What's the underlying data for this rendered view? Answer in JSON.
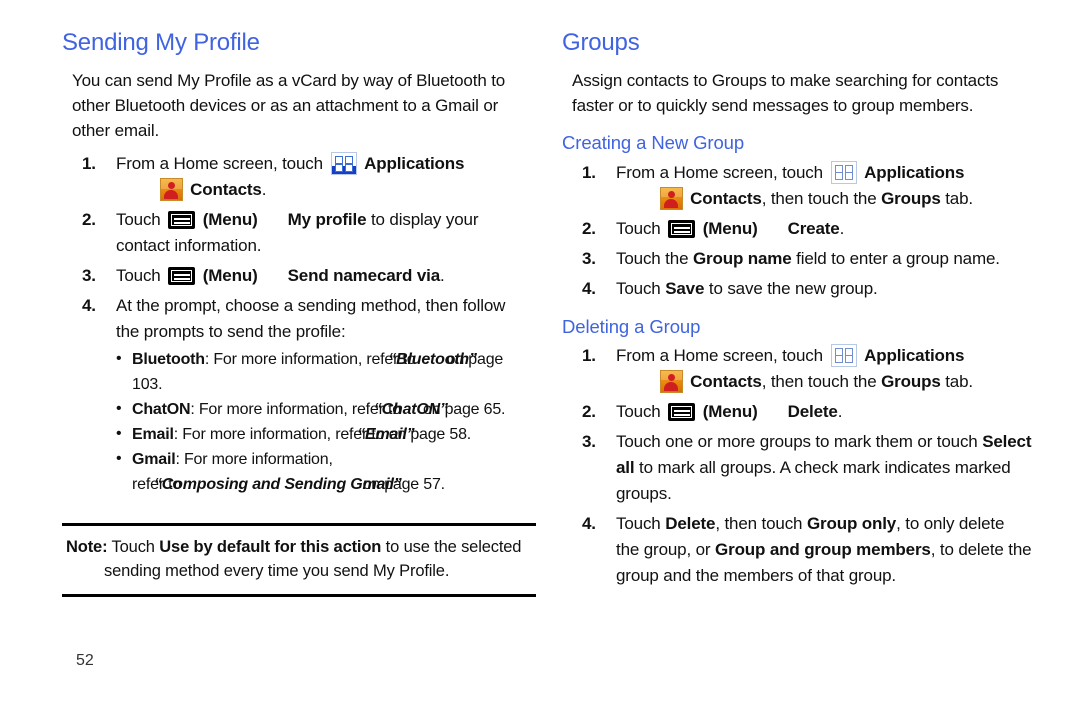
{
  "page": {
    "folio": "52",
    "heading_color": "#4063e0"
  },
  "left_column": {
    "heading": "Sending My Profile",
    "intro": "You can send My Profile as a vCard by way of Bluetooth to other Bluetooth devices or as an attachment to a Gmail or other email.",
    "steps": [
      {
        "num": "1.",
        "pre": "From a Home screen, touch",
        "apps_label": "Applications",
        "contacts_label": "Contacts",
        "post": "."
      },
      {
        "num": "2.",
        "touch": "Touch",
        "menu_label": "(Menu)",
        "command": "My profile",
        "tail": " to display your contact information."
      },
      {
        "num": "3.",
        "touch": "Touch",
        "menu_label": "(Menu)",
        "command": "Send namecard via",
        "tail": "."
      },
      {
        "num": "4.",
        "text": "At the prompt, choose a sending method, then follow the prompts to send the profile:"
      }
    ],
    "bullets": [
      {
        "dot": "•",
        "term": "Bluetooth",
        "mid": ": For more information, ",
        "refer": "refer to",
        "title": "“Bluetooth”",
        "tail": " on page 103."
      },
      {
        "dot": "•",
        "term": "ChatON",
        "mid": ": For more information, ",
        "refer": "refer to",
        "title": "“ChatON”",
        "tail": " on page 65."
      },
      {
        "dot": "•",
        "term": "Email",
        "mid": ": For more information, ",
        "refer": "refer to",
        "title": "“Email”",
        "tail": " on page 58."
      },
      {
        "dot": "•",
        "term": "Gmail",
        "mid": ": For more information, ",
        "refer": "refer to",
        "title": "“Composing and Sending Gmail”",
        "tail": " on page 57."
      }
    ],
    "note": {
      "label": "Note:",
      "lead": " Touch ",
      "emphasis": "Use by default for this action",
      "tail": " to use the selected sending method every time you send My Profile."
    }
  },
  "right_column": {
    "heading": "Groups",
    "intro": "Assign contacts to Groups to make searching for contacts faster or to quickly send messages to group members.",
    "sections": [
      {
        "title": "Creating a New Group",
        "steps": [
          {
            "num": "1.",
            "pre": "From a Home screen, touch",
            "apps_label": "Applications",
            "contacts_label": "Contacts",
            "mid": ", then touch the ",
            "tab": "Groups",
            "tail": " tab."
          },
          {
            "num": "2.",
            "touch": "Touch",
            "menu_label": "(Menu)",
            "command": "Create",
            "tail": "."
          },
          {
            "num": "3.",
            "pre": "Touch the ",
            "field": "Group name",
            "tail": " field to enter a group name."
          },
          {
            "num": "4.",
            "pre": "Touch ",
            "action": "Save",
            "tail": " to save the new group."
          }
        ]
      },
      {
        "title": "Deleting a Group",
        "steps": [
          {
            "num": "1.",
            "pre": "From a Home screen, touch",
            "apps_label": "Applications",
            "contacts_label": "Contacts",
            "mid": ", then touch the ",
            "tab": "Groups",
            "tail": " tab."
          },
          {
            "num": "2.",
            "touch": "Touch",
            "menu_label": "(Menu)",
            "command": "Delete",
            "tail": "."
          },
          {
            "num": "3.",
            "pre": "Touch one or more groups to mark them or touch ",
            "action": "Select all",
            "tail": " to mark all groups. A check mark indicates marked groups."
          },
          {
            "num": "4.",
            "pre": "Touch ",
            "action": "Delete",
            "mid": ", then touch ",
            "action2": "Group only",
            "mid2": ", to only delete the group, or ",
            "action3": "Group and group members",
            "tail": ", to delete the group and the members of that group."
          }
        ]
      }
    ]
  }
}
